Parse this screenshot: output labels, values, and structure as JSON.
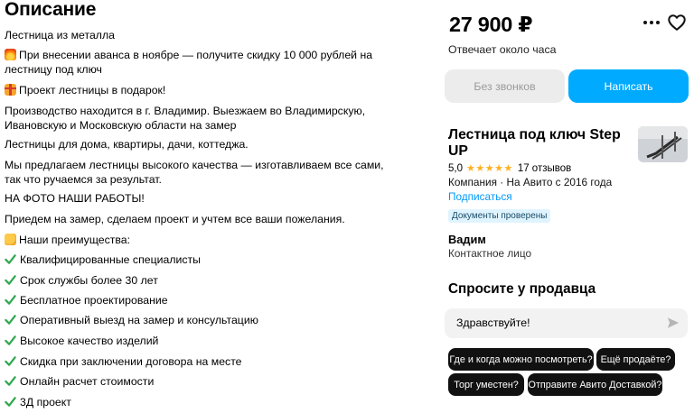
{
  "description": {
    "title": "Описание",
    "paragraphs": [
      "Лестница из металла",
      "При внесении аванса в ноябре — получите скидку 10 000 рублей на лестницу под ключ",
      "Проект лестницы в подарок!",
      "Производство находится в г. Владимир. Выезжаем во Владимирскую, Ивановскую и Московскую области на замер",
      "Лестницы для дома, квартиры, дачи, коттеджа.",
      "Мы предлагаем лестницы высокого качества — изготавливаем все сами, так что ручаемся за результат.",
      "НА ФОТО НАШИ РАБОТЫ!",
      "Приедем на замер, сделаем проект и учтем все ваши пожелания.",
      "Наши преимущества:"
    ],
    "advantages": [
      "Квалифицированные специалисты",
      "Срок службы более 30 лет",
      "Бесплатное проектирование",
      "Оперативный выезд на замер и консультацию",
      "Высокое качество изделий",
      "Скидка при заключении договора на месте",
      "Онлайн расчет стоимости",
      "3Д проект"
    ]
  },
  "listing": {
    "price": "27 900 ₽",
    "reply_time": "Отвечает около часа",
    "no_calls_label": "Без звонков",
    "write_label": "Написать"
  },
  "seller": {
    "name": "Лестница под ключ Step UP",
    "rating": "5,0",
    "stars": "★★★★★",
    "reviews": "17 отзывов",
    "company_info": "Компания · На Авито с 2016 года",
    "subscribe_label": "Подписаться",
    "verified_badge": "Документы проверены",
    "contact_name": "Вадим",
    "contact_role": "Контактное лицо"
  },
  "ask": {
    "title": "Спросите у продавца",
    "message_value": "Здравствуйте!",
    "chips": [
      "Где и когда можно посмотреть?",
      "Ещё продаёте?",
      "Торг уместен?",
      "Отправите Авито Доставкой?"
    ]
  },
  "colors": {
    "accent": "#00aaff",
    "link": "#0099f7",
    "star": "#ffb021",
    "check": "#2fa84f",
    "chip_bg": "#111111"
  }
}
